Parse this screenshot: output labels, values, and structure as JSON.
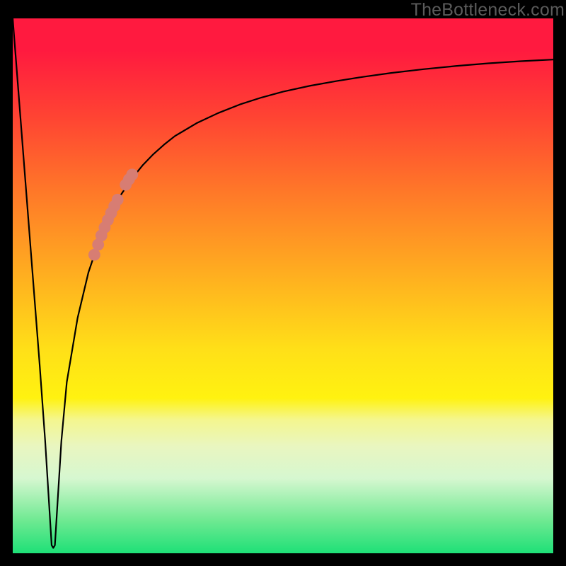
{
  "watermark": "TheBottleneck.com",
  "chart_data": {
    "type": "line",
    "title": "",
    "xlabel": "",
    "ylabel": "",
    "xlim": [
      0,
      100
    ],
    "ylim": [
      0,
      100
    ],
    "x_at_minimum": 7.5,
    "series": [
      {
        "name": "bottleneck-curve",
        "color": "#000000",
        "x": [
          0,
          1,
          2,
          3,
          4,
          5,
          6,
          6.8,
          7.2,
          7.5,
          7.8,
          8.2,
          9,
          10,
          12,
          14,
          16,
          18,
          20,
          22,
          24,
          26,
          28,
          30,
          34,
          38,
          42,
          46,
          50,
          55,
          60,
          65,
          70,
          76,
          82,
          88,
          94,
          100
        ],
        "y": [
          100,
          87,
          74,
          61,
          48,
          35,
          21,
          8,
          1.5,
          1,
          1.5,
          8,
          21,
          32,
          44,
          52.5,
          58.5,
          63,
          67,
          70,
          72.5,
          74.6,
          76.4,
          78,
          80.4,
          82.3,
          83.9,
          85.2,
          86.3,
          87.4,
          88.3,
          89.1,
          89.8,
          90.5,
          91.1,
          91.6,
          92,
          92.3
        ]
      }
    ],
    "highlight_points": {
      "name": "highlight-segment",
      "color": "#d77d73",
      "radius_fraction": 0.011,
      "points": [
        {
          "x": 15.1,
          "y": 55.8
        },
        {
          "x": 15.8,
          "y": 57.7
        },
        {
          "x": 16.4,
          "y": 59.4
        },
        {
          "x": 17.0,
          "y": 60.9
        },
        {
          "x": 17.6,
          "y": 62.3
        },
        {
          "x": 18.2,
          "y": 63.6
        },
        {
          "x": 18.8,
          "y": 64.9
        },
        {
          "x": 19.4,
          "y": 66.1
        },
        {
          "x": 20.9,
          "y": 68.9
        },
        {
          "x": 21.5,
          "y": 69.9
        },
        {
          "x": 22.1,
          "y": 70.8
        }
      ]
    }
  }
}
